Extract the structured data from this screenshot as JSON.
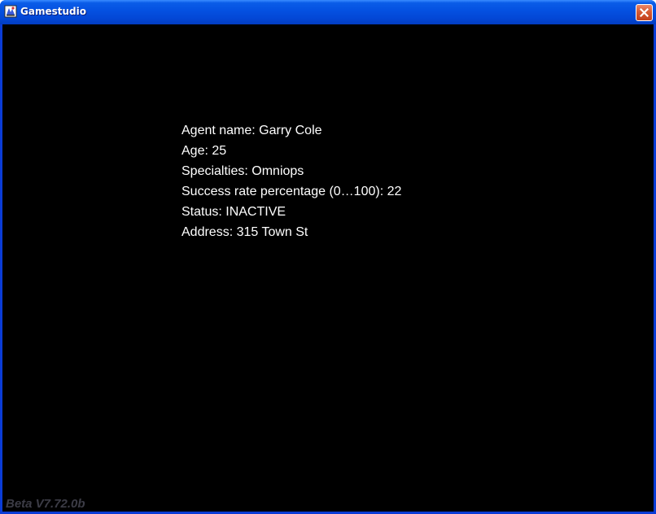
{
  "window": {
    "title": "Gamestudio",
    "icon": "gamestudio-app-icon",
    "close_icon": "close-icon"
  },
  "agent": {
    "name_line": "Agent name: Garry Cole",
    "age_line": "Age: 25",
    "specialties_line": "Specialties: Omniops",
    "success_rate_line": "Success rate percentage (0…100): 22",
    "status_line": "Status: INACTIVE",
    "address_line": "Address: 315 Town St"
  },
  "footer": {
    "version": "Beta V7.72.0b"
  },
  "colors": {
    "titlebar": "#0450e0",
    "client_background": "#000000",
    "text": "#ffffff",
    "version_text": "#3c3c46",
    "close_button": "#d65a33"
  }
}
